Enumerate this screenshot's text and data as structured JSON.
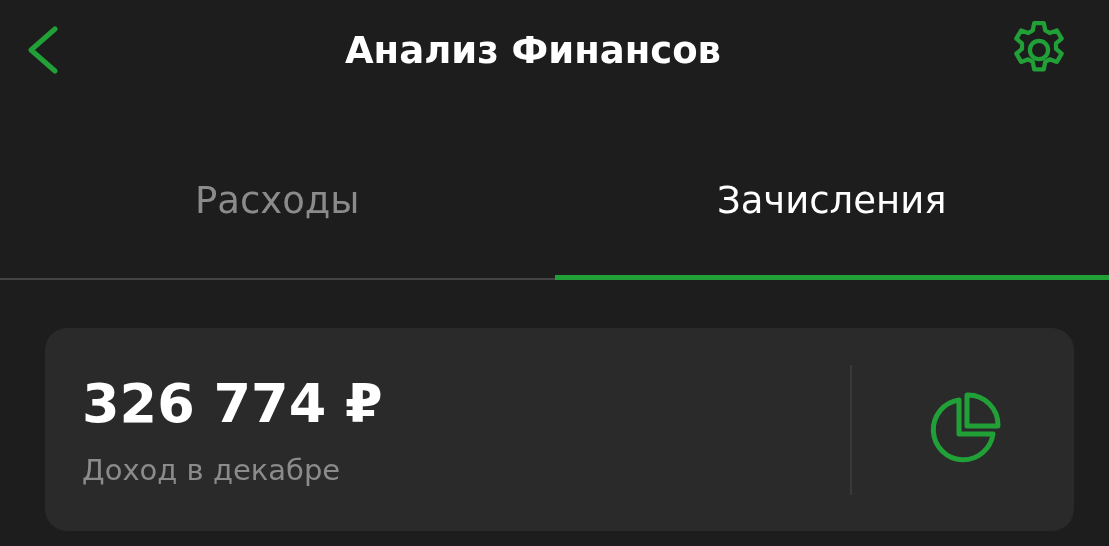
{
  "header": {
    "title": "Анализ Финансов"
  },
  "tabs": [
    {
      "label": "Расходы",
      "selected": false
    },
    {
      "label": "Зачисления",
      "selected": true
    }
  ],
  "summary": {
    "amount": "326 774 ₽",
    "caption": "Доход в декабре"
  }
}
